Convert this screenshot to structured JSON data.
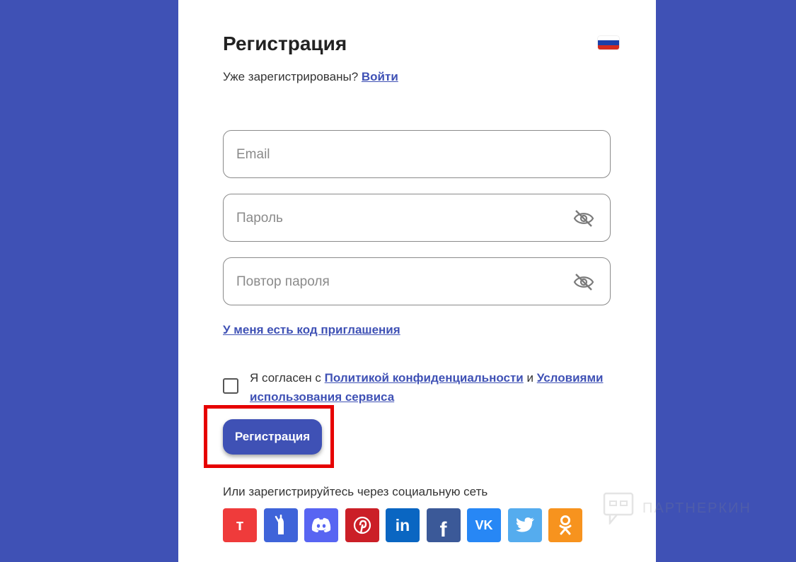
{
  "form": {
    "title": "Регистрация",
    "already_registered": "Уже зарегистрированы?",
    "login_link": "Войти",
    "email_placeholder": "Email",
    "password_placeholder": "Пароль",
    "repeat_password_placeholder": "Повтор пароля",
    "invite_link": "У меня есть код приглашения",
    "agree_prefix": "Я согласен с",
    "privacy_link": "Политикой конфиденциальности",
    "agree_and": "и",
    "terms_link": "Условиями использования сервиса",
    "submit_label": "Регистрация",
    "social_text": "Или зарегистрируйтесь через социальную сеть"
  },
  "language_flag": {
    "icon": "russia-flag-icon",
    "colors": [
      "#ffffff",
      "#1c3fa8",
      "#d52b1e"
    ]
  },
  "socials": [
    {
      "name": "t-social",
      "icon": "t-icon",
      "glyph": "т",
      "color": "#ef3b3b"
    },
    {
      "name": "rocket-social",
      "icon": "rocket-icon",
      "glyph": "",
      "color": "#3f64d9"
    },
    {
      "name": "discord-social",
      "icon": "discord-icon",
      "glyph": "",
      "color": "#5865f2"
    },
    {
      "name": "pinterest-social",
      "icon": "pinterest-icon",
      "glyph": "P",
      "color": "#cb1f27"
    },
    {
      "name": "linkedin-social",
      "icon": "linkedin-icon",
      "glyph": "in",
      "color": "#0a66c2"
    },
    {
      "name": "facebook-social",
      "icon": "facebook-icon",
      "glyph": "f",
      "color": "#3b5998"
    },
    {
      "name": "vk-social",
      "icon": "vk-icon",
      "glyph": "VK",
      "color": "#2787f5"
    },
    {
      "name": "twitter-social",
      "icon": "twitter-icon",
      "glyph": "",
      "color": "#55acee"
    },
    {
      "name": "odnoklassniki-social",
      "icon": "odnoklassniki-icon",
      "glyph": "",
      "color": "#f7931e"
    }
  ],
  "watermark": {
    "text": "ПАРТНЕРКИН"
  },
  "colors": {
    "background": "#3f51b5",
    "accent": "#3f51b5",
    "highlight": "#e60000"
  }
}
